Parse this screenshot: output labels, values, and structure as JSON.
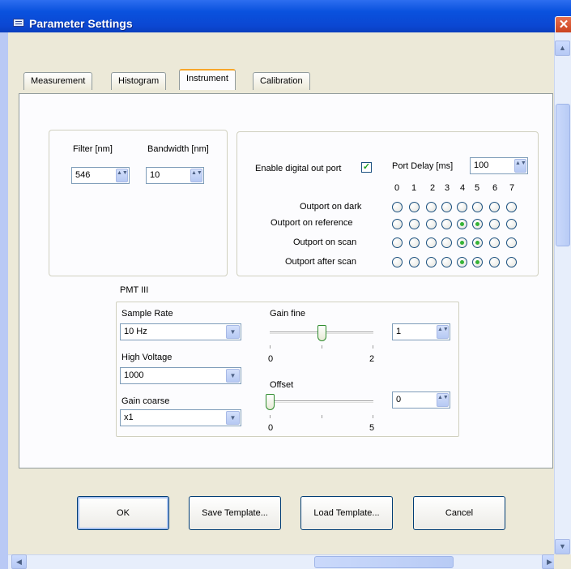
{
  "window": {
    "title": "Parameter Settings",
    "close_glyph": "✕",
    "icon": "app-icon"
  },
  "tabs": [
    "Measurement",
    "Histogram",
    "Instrument",
    "Calibration"
  ],
  "active_tab": "Instrument",
  "filter": {
    "filter_label": "Filter [nm]",
    "filter_value": "546",
    "bandwidth_label": "Bandwidth [nm]",
    "bandwidth_value": "10"
  },
  "digital_out": {
    "enable_label": "Enable digital out port",
    "enable_checked": true,
    "check_glyph": "✓",
    "port_delay_label": "Port Delay [ms]",
    "port_delay_value": "100",
    "bits": [
      "0",
      "1",
      "2",
      "3",
      "4",
      "5",
      "6",
      "7"
    ],
    "rows": [
      {
        "label": "Outport on dark",
        "selected_bits": []
      },
      {
        "label": "Outport on reference",
        "selected_bits": [
          4,
          5
        ]
      },
      {
        "label": "Outport on scan",
        "selected_bits": [
          4,
          5
        ]
      },
      {
        "label": "Outport after scan",
        "selected_bits": [
          4,
          5
        ]
      }
    ]
  },
  "pmt": {
    "group_label": "PMT III",
    "sample_rate_label": "Sample Rate",
    "sample_rate_value": "10 Hz",
    "high_voltage_label": "High Voltage",
    "high_voltage_value": "1000",
    "gain_coarse_label": "Gain coarse",
    "gain_coarse_value": "x1",
    "gain_fine_label": "Gain fine",
    "gain_fine_min": "0",
    "gain_fine_max": "2",
    "gain_fine_value": "1",
    "gain_fine_fraction": 0.5,
    "offset_label": "Offset",
    "offset_min": "0",
    "offset_max": "5",
    "offset_value": "0",
    "offset_fraction": 0.0
  },
  "buttons": {
    "ok": "OK",
    "save_template": "Save Template...",
    "load_template": "Load Template...",
    "cancel": "Cancel"
  },
  "scroll": {
    "up_glyph": "▲",
    "down_glyph": "▼",
    "left_glyph": "◀",
    "right_glyph": "▶",
    "spin_glyph": "▲▼",
    "dropdown_glyph": "▼"
  },
  "colors": {
    "title_bar": "#0a52de",
    "active_tab_accent": "#f7a62a",
    "radio_selected": "#36b336",
    "dialog_bg": "#ece9d8"
  }
}
